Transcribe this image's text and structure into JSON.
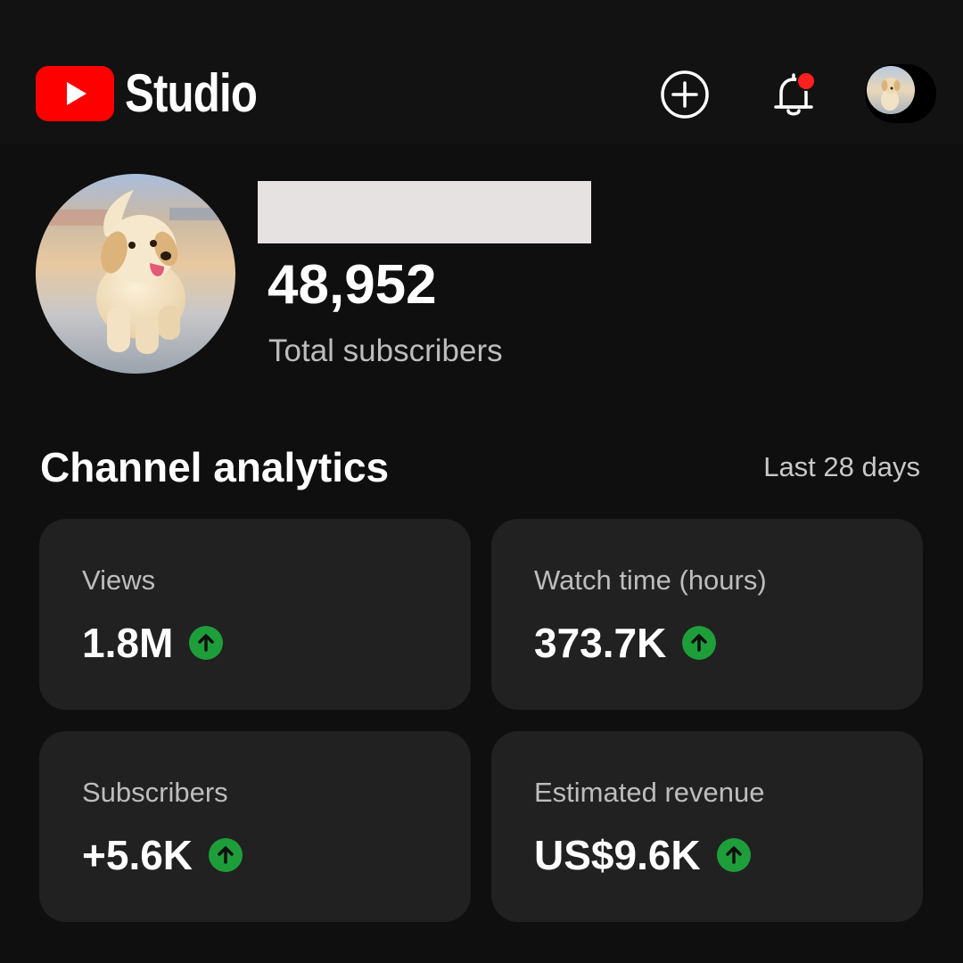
{
  "header": {
    "brand": "Studio",
    "icons": [
      "youtube-logo-icon",
      "create-plus-icon",
      "notification-bell-icon",
      "account-avatar"
    ],
    "notification_dot_color": "#ff2020"
  },
  "channel": {
    "subscriber_count": "48,952",
    "subscriber_label": "Total subscribers"
  },
  "analytics": {
    "title": "Channel analytics",
    "range": "Last 28 days",
    "cards": [
      {
        "label": "Views",
        "value": "1.8M",
        "trend": "up"
      },
      {
        "label": "Watch time (hours)",
        "value": "373.7K",
        "trend": "up"
      },
      {
        "label": "Subscribers",
        "value": "+5.6K",
        "trend": "up"
      },
      {
        "label": "Estimated revenue",
        "value": "US$9.6K",
        "trend": "up"
      }
    ]
  },
  "colors": {
    "background": "#0f0f0f",
    "card": "#212121",
    "brand_red": "#ff0000",
    "trend_up": "#1e9e3a"
  }
}
